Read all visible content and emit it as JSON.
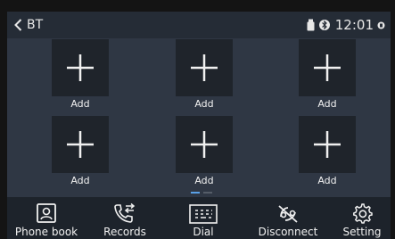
{
  "topbar": {
    "back_label": "BT",
    "time": "12:01",
    "icons": [
      "usb-icon",
      "bluetooth-icon",
      "notification-dot-icon"
    ]
  },
  "favorites": [
    {
      "label": "Add"
    },
    {
      "label": "Add"
    },
    {
      "label": "Add"
    },
    {
      "label": "Add"
    },
    {
      "label": "Add"
    },
    {
      "label": "Add"
    }
  ],
  "pager": {
    "pages": 2,
    "current": 1
  },
  "bottom_nav": [
    {
      "label": "Phone book",
      "icon": "phone-book-icon"
    },
    {
      "label": "Records",
      "icon": "call-records-icon"
    },
    {
      "label": "Dial",
      "icon": "dialpad-icon"
    },
    {
      "label": "Disconnect",
      "icon": "disconnect-icon"
    },
    {
      "label": "Setting",
      "icon": "gear-icon"
    }
  ],
  "colors": {
    "background": "#2f3744",
    "tile": "#1f242b",
    "text": "#f0f0f0",
    "pager_active": "#5aa0e6",
    "pager_inactive": "#555d68"
  }
}
